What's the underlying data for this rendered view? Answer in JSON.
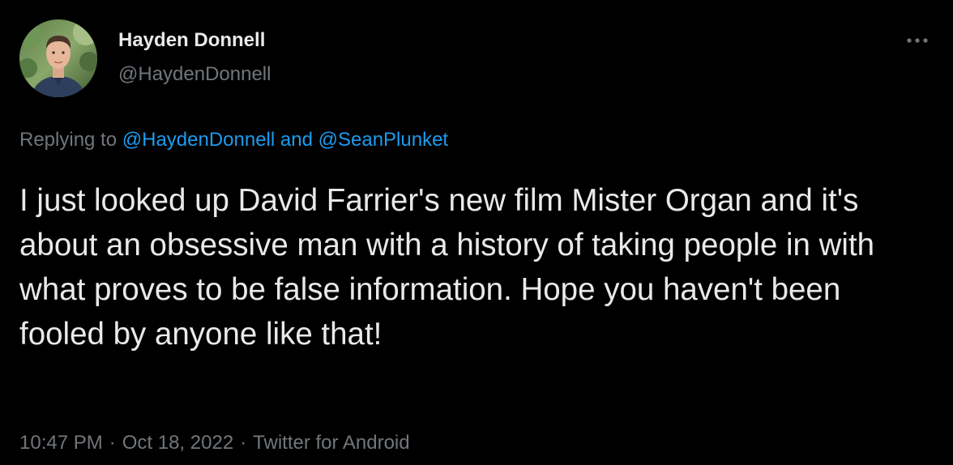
{
  "author": {
    "display_name": "Hayden Donnell",
    "handle": "@HaydenDonnell"
  },
  "more_icon": "more-horizontal-icon",
  "reply_context": {
    "prefix": "Replying to ",
    "mention_1": "@HaydenDonnell",
    "joiner": " and ",
    "mention_2": "@SeanPlunket"
  },
  "tweet": {
    "text": "I just looked up David Farrier's new film Mister Organ and it's about an obsessive man with a history of taking people in with what proves to be false information. Hope you haven't been fooled by anyone like that!"
  },
  "meta": {
    "time": "10:47 PM",
    "separator": "·",
    "date": "Oct 18, 2022",
    "source": "Twitter for Android"
  },
  "colors": {
    "background": "#000000",
    "text_primary": "#e7e9ea",
    "text_secondary": "#71767b",
    "link": "#1d9bf0"
  }
}
